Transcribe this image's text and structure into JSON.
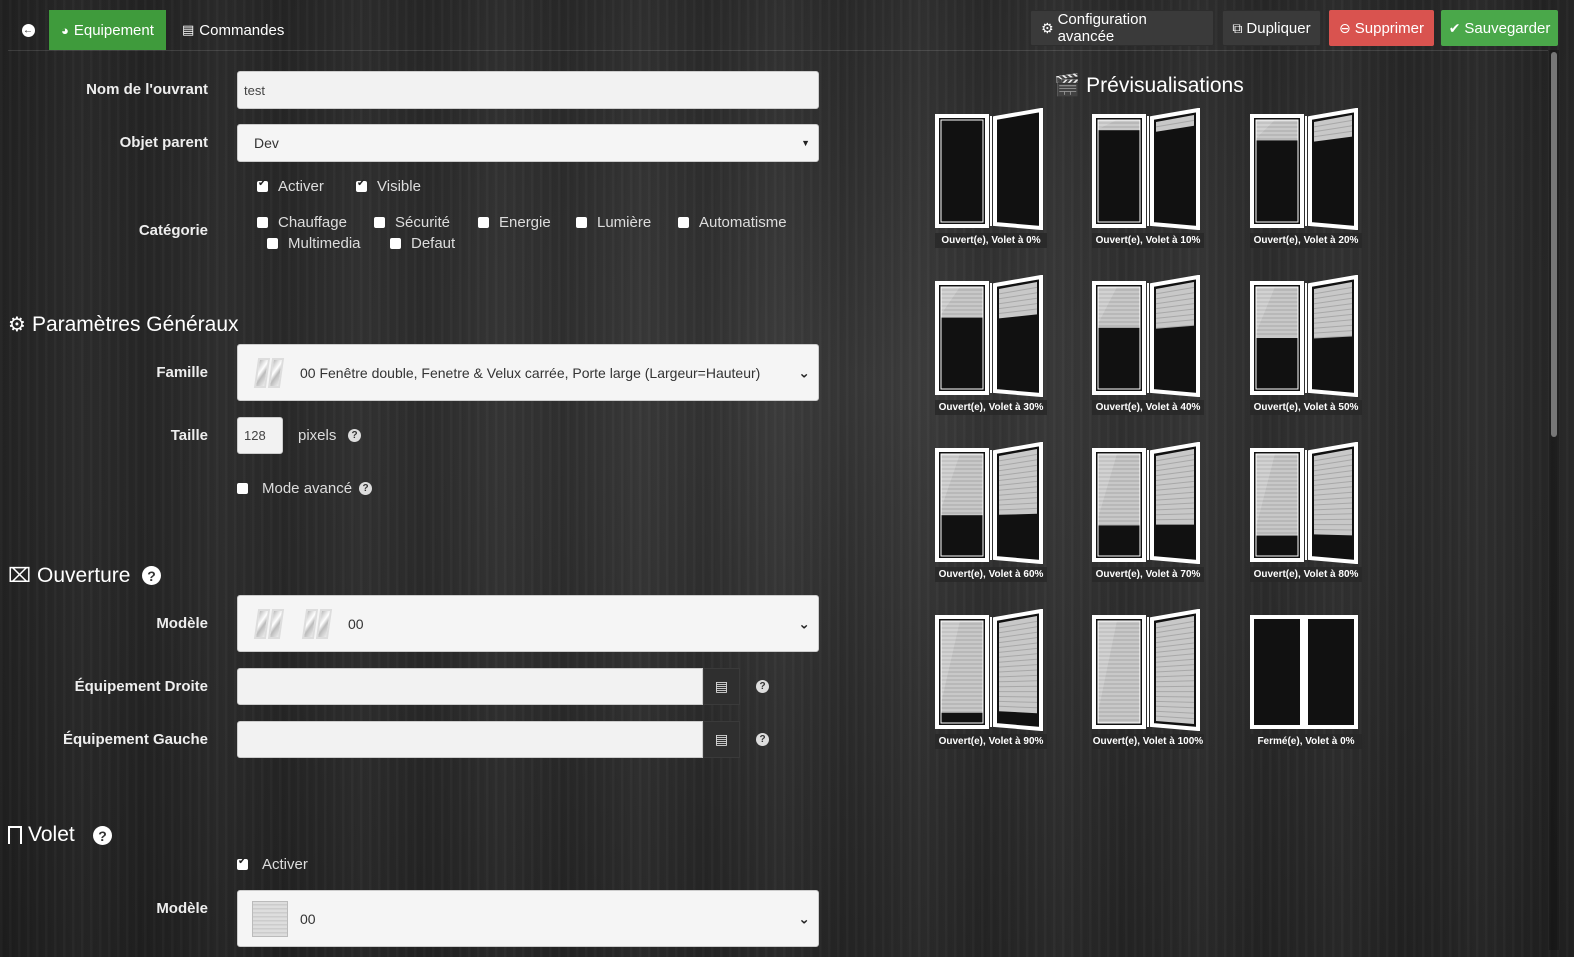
{
  "tabs": {
    "back_icon": "arrow-circle-left-icon",
    "equipement": "Equipement",
    "commandes": "Commandes"
  },
  "actions": {
    "config": "Configuration avancée",
    "dupliquer": "Dupliquer",
    "supprimer": "Supprimer",
    "sauvegarder": "Sauvegarder"
  },
  "form": {
    "nom_label": "Nom de l'ouvrant",
    "nom_value": "test",
    "parent_label": "Objet parent",
    "parent_value": "Dev",
    "activer": "Activer",
    "visible": "Visible",
    "categorie_label": "Catégorie",
    "categories": [
      "Chauffage",
      "Sécurité",
      "Energie",
      "Lumière",
      "Automatisme",
      "Multimedia",
      "Defaut"
    ]
  },
  "general": {
    "title": "Paramètres Généraux",
    "famille_label": "Famille",
    "famille_value": "00 Fenêtre double, Fenetre & Velux carrée, Porte large (Largeur=Hauteur)",
    "taille_label": "Taille",
    "taille_value": "128",
    "taille_unit": "pixels",
    "mode_avance": "Mode avancé"
  },
  "ouverture": {
    "title": "Ouverture",
    "modele_label": "Modèle",
    "modele_value": "00",
    "droite_label": "Équipement Droite",
    "gauche_label": "Équipement Gauche"
  },
  "volet": {
    "title": "Volet",
    "activer": "Activer",
    "modele_label": "Modèle",
    "modele_value": "00"
  },
  "preview": {
    "title": "Prévisualisations",
    "items": [
      {
        "caption": "Ouvert(e), Volet à 0%",
        "shutter": 0,
        "open": true
      },
      {
        "caption": "Ouvert(e), Volet à 10%",
        "shutter": 10,
        "open": true
      },
      {
        "caption": "Ouvert(e), Volet à 20%",
        "shutter": 20,
        "open": true
      },
      {
        "caption": "Ouvert(e), Volet à 30%",
        "shutter": 30,
        "open": true
      },
      {
        "caption": "Ouvert(e), Volet à 40%",
        "shutter": 40,
        "open": true
      },
      {
        "caption": "Ouvert(e), Volet à 50%",
        "shutter": 50,
        "open": true
      },
      {
        "caption": "Ouvert(e), Volet à 60%",
        "shutter": 60,
        "open": true
      },
      {
        "caption": "Ouvert(e), Volet à 70%",
        "shutter": 70,
        "open": true
      },
      {
        "caption": "Ouvert(e), Volet à 80%",
        "shutter": 80,
        "open": true
      },
      {
        "caption": "Ouvert(e), Volet à 90%",
        "shutter": 90,
        "open": true
      },
      {
        "caption": "Ouvert(e), Volet à 100%",
        "shutter": 100,
        "open": true
      },
      {
        "caption": "Fermé(e), Volet à 0%",
        "shutter": 0,
        "open": false
      }
    ]
  },
  "colors": {
    "active_tab": "#3f9b3c",
    "danger": "#d9534f",
    "success": "#4aa84a"
  }
}
